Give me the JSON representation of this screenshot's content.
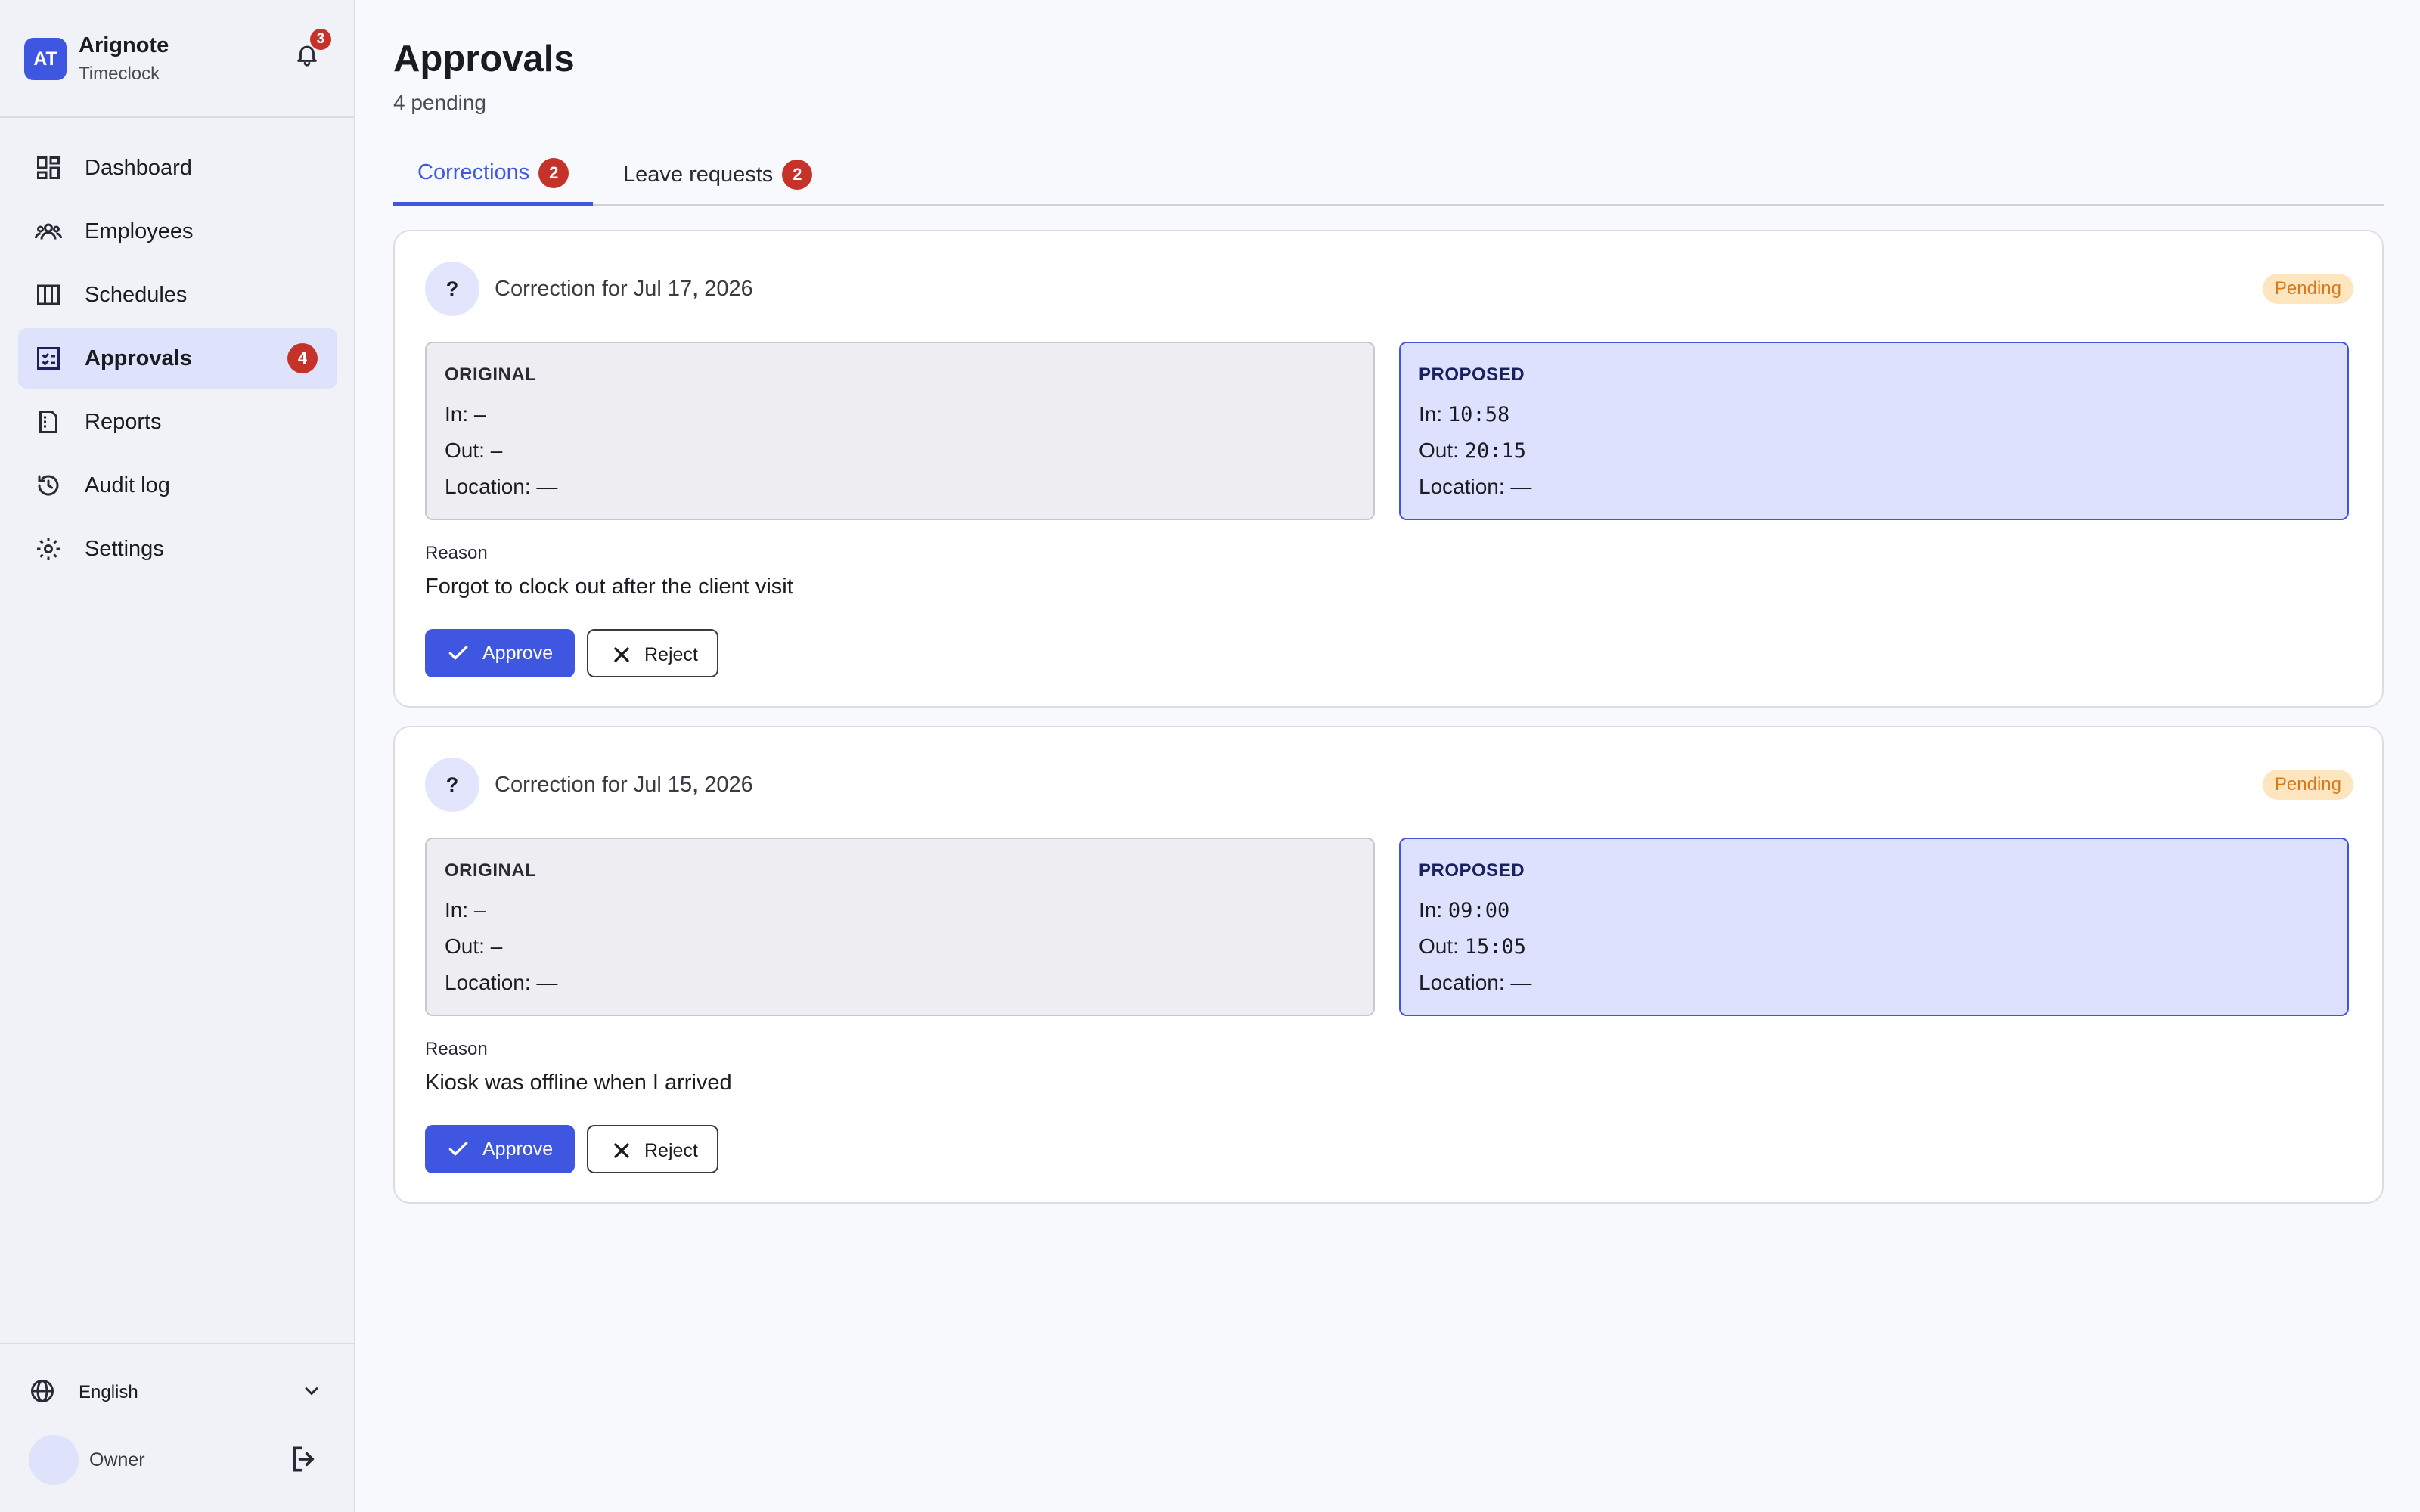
{
  "brand": {
    "initials": "AT",
    "name": "Arignote",
    "subtitle": "Timeclock"
  },
  "notifications": {
    "count": "3"
  },
  "sidebar": {
    "items": [
      {
        "label": "Dashboard",
        "icon": "dashboard-icon"
      },
      {
        "label": "Employees",
        "icon": "users-icon"
      },
      {
        "label": "Schedules",
        "icon": "calendar-grid-icon"
      },
      {
        "label": "Approvals",
        "icon": "checklist-icon",
        "badge": "4",
        "active": true
      },
      {
        "label": "Reports",
        "icon": "report-icon"
      },
      {
        "label": "Audit log",
        "icon": "history-icon"
      },
      {
        "label": "Settings",
        "icon": "gear-icon"
      }
    ],
    "language": "English",
    "user": "Owner"
  },
  "page": {
    "title": "Approvals",
    "subtitle": "4 pending"
  },
  "tabs": [
    {
      "label": "Corrections",
      "badge": "2",
      "active": true
    },
    {
      "label": "Leave requests",
      "badge": "2",
      "active": false
    }
  ],
  "cards": [
    {
      "icon_text": "?",
      "title": "Correction for Jul 17, 2026",
      "status": "Pending",
      "original": {
        "heading": "ORIGINAL",
        "in_label": "In:",
        "in": "–",
        "out_label": "Out:",
        "out": "–",
        "location_label": "Location:",
        "location": "—"
      },
      "proposed": {
        "heading": "PROPOSED",
        "in_label": "In:",
        "in": "10:58",
        "out_label": "Out:",
        "out": "20:15",
        "location_label": "Location:",
        "location": "—"
      },
      "reason_label": "Reason",
      "reason": "Forgot to clock out after the client visit",
      "approve_label": "Approve",
      "reject_label": "Reject"
    },
    {
      "icon_text": "?",
      "title": "Correction for Jul 15, 2026",
      "status": "Pending",
      "original": {
        "heading": "ORIGINAL",
        "in_label": "In:",
        "in": "–",
        "out_label": "Out:",
        "out": "–",
        "location_label": "Location:",
        "location": "—"
      },
      "proposed": {
        "heading": "PROPOSED",
        "in_label": "In:",
        "in": "09:00",
        "out_label": "Out:",
        "out": "15:05",
        "location_label": "Location:",
        "location": "—"
      },
      "reason_label": "Reason",
      "reason": "Kiosk was offline when I arrived",
      "approve_label": "Approve",
      "reject_label": "Reject"
    }
  ],
  "colors": {
    "accent": "#3f56e0",
    "badge": "#c5322a",
    "pending_bg": "#fde5c0",
    "pending_text": "#d9791a",
    "proposed_bg": "#dde1fd"
  }
}
